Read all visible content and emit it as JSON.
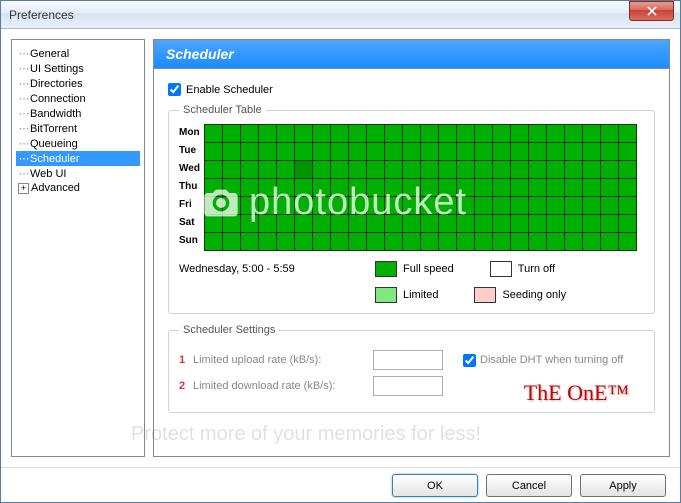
{
  "window": {
    "title": "Preferences"
  },
  "sidebar": {
    "items": [
      {
        "label": "General"
      },
      {
        "label": "UI Settings"
      },
      {
        "label": "Directories"
      },
      {
        "label": "Connection"
      },
      {
        "label": "Bandwidth"
      },
      {
        "label": "BitTorrent"
      },
      {
        "label": "Queueing"
      },
      {
        "label": "Scheduler"
      },
      {
        "label": "Web UI"
      },
      {
        "label": "Advanced"
      }
    ]
  },
  "panel": {
    "title": "Scheduler",
    "enable_label": "Enable Scheduler",
    "table_legend": "Scheduler Table",
    "settings_legend": "Scheduler Settings",
    "days": [
      "Mon",
      "Tue",
      "Wed",
      "Thu",
      "Fri",
      "Sat",
      "Sun"
    ],
    "time_readout": "Wednesday, 5:00 - 5:59",
    "legend": {
      "full": "Full speed",
      "limited": "Limited",
      "off": "Turn off",
      "seed": "Seeding only"
    },
    "settings": {
      "upload_label": "Limited upload rate (kB/s):",
      "download_label": "Limited download rate (kB/s):",
      "dht_label": "Disable DHT when turning off",
      "upload_value": "",
      "download_value": ""
    }
  },
  "buttons": {
    "ok": "OK",
    "cancel": "Cancel",
    "apply": "Apply"
  },
  "annotations": {
    "one": "1",
    "two": "2",
    "sig": "ThE OnE™"
  },
  "chart_data": {
    "type": "table",
    "rows": [
      "Mon",
      "Tue",
      "Wed",
      "Thu",
      "Fri",
      "Sat",
      "Sun"
    ],
    "cols_hours": 24,
    "cell_state": "full_speed",
    "highlight": {
      "row": "Wed",
      "hour": 5
    }
  }
}
